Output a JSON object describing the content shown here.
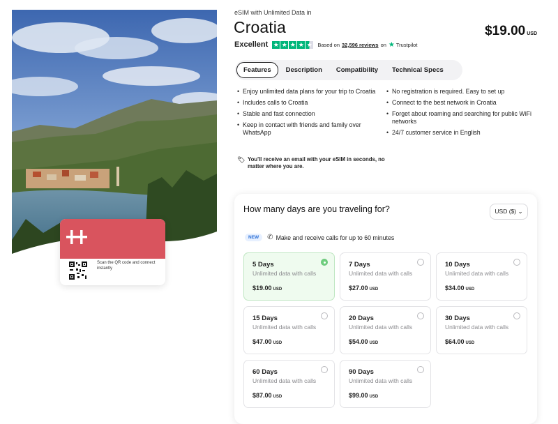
{
  "product": {
    "eyebrow": "eSIM with Unlimited Data in",
    "title": "Croatia",
    "price": "$19.00",
    "price_currency": "USD"
  },
  "rating": {
    "label": "Excellent",
    "stars": 4.5,
    "based_on": "Based on",
    "count": "32,596 reviews",
    "on": "on",
    "provider": "Trustpilot",
    "color": "#00b67a"
  },
  "tabs": [
    {
      "label": "Features",
      "active": true
    },
    {
      "label": "Description",
      "active": false
    },
    {
      "label": "Compatibility",
      "active": false
    },
    {
      "label": "Technical Specs",
      "active": false
    }
  ],
  "features": {
    "left": [
      "Enjoy unlimited data plans for your trip to Croatia",
      "Includes calls to Croatia",
      "Stable and fast connection",
      "Keep in contact with friends and family over WhatsApp"
    ],
    "right": [
      "No registration is required. Easy to set up",
      "Connect to the best network in Croatia",
      "Forget about roaming and searching for public WiFi networks",
      "24/7 customer service in English"
    ],
    "email_note": "You'll receive an email with your eSIM in seconds, no matter where you are.",
    "email_icon": "tag-icon"
  },
  "esim_card": {
    "scan_text": "Scan the QR code and connect instantly",
    "brand_color": "#d9545e"
  },
  "days_panel": {
    "title": "How many days are you traveling for?",
    "currency": "USD ($)",
    "new_badge": "NEW",
    "calls_text": "Make and receive calls for up to 60 minutes",
    "plans": [
      {
        "days": "5 Days",
        "desc": "Unlimited data with calls",
        "price": "$19.00",
        "currency": "USD",
        "selected": true
      },
      {
        "days": "7 Days",
        "desc": "Unlimited data with calls",
        "price": "$27.00",
        "currency": "USD",
        "selected": false
      },
      {
        "days": "10 Days",
        "desc": "Unlimited data with calls",
        "price": "$34.00",
        "currency": "USD",
        "selected": false
      },
      {
        "days": "15 Days",
        "desc": "Unlimited data with calls",
        "price": "$47.00",
        "currency": "USD",
        "selected": false
      },
      {
        "days": "20 Days",
        "desc": "Unlimited data with calls",
        "price": "$54.00",
        "currency": "USD",
        "selected": false
      },
      {
        "days": "30 Days",
        "desc": "Unlimited data with calls",
        "price": "$64.00",
        "currency": "USD",
        "selected": false
      },
      {
        "days": "60 Days",
        "desc": "Unlimited data with calls",
        "price": "$87.00",
        "currency": "USD",
        "selected": false
      },
      {
        "days": "90 Days",
        "desc": "Unlimited data with calls",
        "price": "$99.00",
        "currency": "USD",
        "selected": false
      }
    ]
  }
}
